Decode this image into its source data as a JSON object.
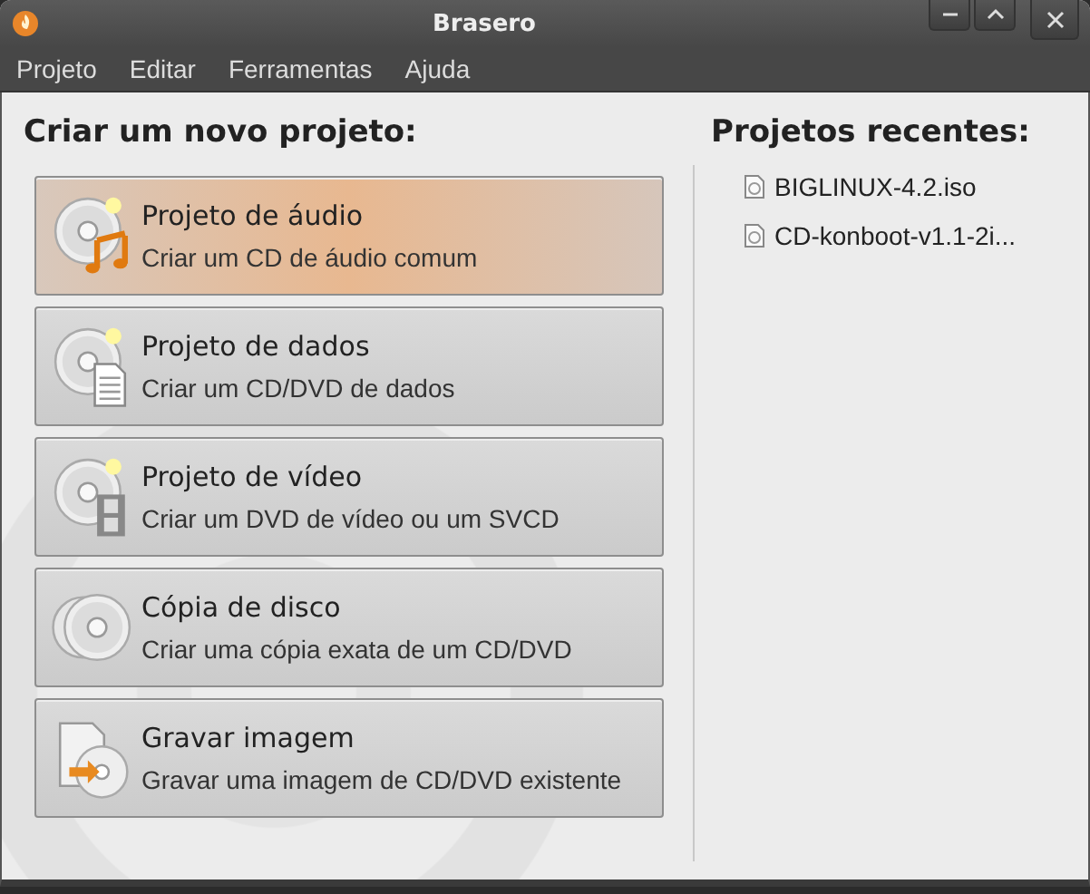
{
  "window": {
    "title": "Brasero"
  },
  "menu": [
    "Projeto",
    "Editar",
    "Ferramentas",
    "Ajuda"
  ],
  "new_project": {
    "heading": "Criar um novo projeto:",
    "items": [
      {
        "kind": "audio",
        "title": "Projeto de áudio",
        "subtitle": "Criar um CD de áudio comum",
        "selected": true
      },
      {
        "kind": "data",
        "title": "Projeto de dados",
        "subtitle": "Criar um CD/DVD de dados",
        "selected": false
      },
      {
        "kind": "video",
        "title": "Projeto de vídeo",
        "subtitle": "Criar um DVD de vídeo ou um SVCD",
        "selected": false
      },
      {
        "kind": "copy",
        "title": "Cópia de disco",
        "subtitle": "Criar uma cópia exata de um CD/DVD",
        "selected": false
      },
      {
        "kind": "image",
        "title": "Gravar imagem",
        "subtitle": "Gravar uma imagem de CD/DVD existente",
        "selected": false
      }
    ]
  },
  "recent": {
    "heading": "Projetos recentes:",
    "items": [
      "BIGLINUX-4.2.iso",
      "CD-konboot-v1.1-2i..."
    ]
  }
}
